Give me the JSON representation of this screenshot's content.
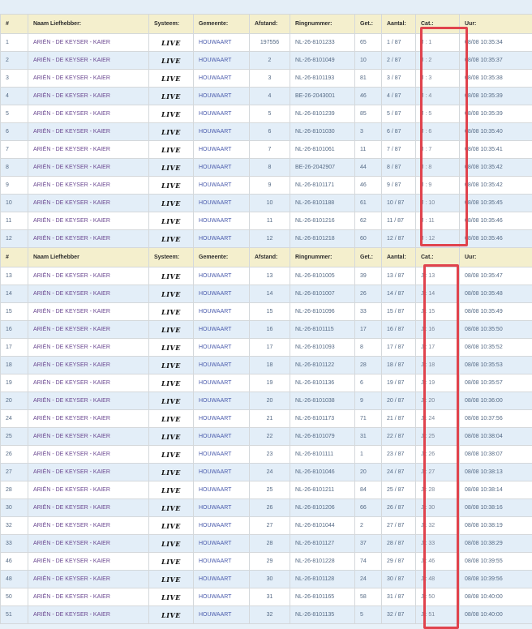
{
  "headers": {
    "nr": "#",
    "name": "Naam Liefhebber:",
    "system": "Systeem:",
    "gemeente": "Gemeente:",
    "afstand": "Afstand:",
    "ring": "Ringnummer:",
    "get": "Get.:",
    "aantal": "Aantal:",
    "cat": "Cat.:",
    "uur": "Uur:"
  },
  "headers2": {
    "nr": "#",
    "name": "Naam Liefhebber",
    "system": "Systeem:",
    "gemeente": "Gemeente:",
    "afstand": "Afstand:",
    "ring": "Ringnummer:",
    "get": "Get.:",
    "aantal": "Aantal:",
    "cat": "Cat.:",
    "uur": "Uur:"
  },
  "system_logo": "LIVE",
  "table1": [
    {
      "nr": "1",
      "name": "ARIËN - DE KEYSER - KAIER",
      "gem": "HOUWAART",
      "af": "197556",
      "ring": "NL-26-8101233",
      "get": "65",
      "aantal": "1 / 87",
      "cat": "J : 1",
      "uur": "08/08 10:35:34"
    },
    {
      "nr": "2",
      "name": "ARIËN - DE KEYSER - KAIER",
      "gem": "HOUWAART",
      "af": "2",
      "ring": "NL-26-8101049",
      "get": "10",
      "aantal": "2 / 87",
      "cat": "J : 2",
      "uur": "08/08 10:35:37"
    },
    {
      "nr": "3",
      "name": "ARIËN - DE KEYSER - KAIER",
      "gem": "HOUWAART",
      "af": "3",
      "ring": "NL-26-8101193",
      "get": "81",
      "aantal": "3 / 87",
      "cat": "J : 3",
      "uur": "08/08 10:35:38"
    },
    {
      "nr": "4",
      "name": "ARIËN - DE KEYSER - KAIER",
      "gem": "HOUWAART",
      "af": "4",
      "ring": "BE-26-2043001",
      "get": "46",
      "aantal": "4 / 87",
      "cat": "J : 4",
      "uur": "08/08 10:35:39"
    },
    {
      "nr": "5",
      "name": "ARIËN - DE KEYSER - KAIER",
      "gem": "HOUWAART",
      "af": "5",
      "ring": "NL-26-8101239",
      "get": "85",
      "aantal": "5 / 87",
      "cat": "J : 5",
      "uur": "08/08 10:35:39"
    },
    {
      "nr": "6",
      "name": "ARIËN - DE KEYSER - KAIER",
      "gem": "HOUWAART",
      "af": "6",
      "ring": "NL-26-8101030",
      "get": "3",
      "aantal": "6 / 87",
      "cat": "J : 6",
      "uur": "08/08 10:35:40"
    },
    {
      "nr": "7",
      "name": "ARIËN - DE KEYSER - KAIER",
      "gem": "HOUWAART",
      "af": "7",
      "ring": "NL-26-8101061",
      "get": "11",
      "aantal": "7 / 87",
      "cat": "J : 7",
      "uur": "08/08 10:35:41"
    },
    {
      "nr": "8",
      "name": "ARIËN - DE KEYSER - KAIER",
      "gem": "HOUWAART",
      "af": "8",
      "ring": "BE-26-2042907",
      "get": "44",
      "aantal": "8 / 87",
      "cat": "J : 8",
      "uur": "08/08 10:35:42"
    },
    {
      "nr": "9",
      "name": "ARIËN - DE KEYSER - KAIER",
      "gem": "HOUWAART",
      "af": "9",
      "ring": "NL-26-8101171",
      "get": "46",
      "aantal": "9 / 87",
      "cat": "J : 9",
      "uur": "08/08 10:35:42"
    },
    {
      "nr": "10",
      "name": "ARIËN - DE KEYSER - KAIER",
      "gem": "HOUWAART",
      "af": "10",
      "ring": "NL-26-8101188",
      "get": "61",
      "aantal": "10 / 87",
      "cat": "J : 10",
      "uur": "08/08 10:35:45"
    },
    {
      "nr": "11",
      "name": "ARIËN - DE KEYSER - KAIER",
      "gem": "HOUWAART",
      "af": "11",
      "ring": "NL-26-8101216",
      "get": "62",
      "aantal": "11 / 87",
      "cat": "J : 11",
      "uur": "08/08 10:35:46"
    },
    {
      "nr": "12",
      "name": "ARIËN - DE KEYSER - KAIER",
      "gem": "HOUWAART",
      "af": "12",
      "ring": "NL-26-8101218",
      "get": "60",
      "aantal": "12 / 87",
      "cat": "J : 12",
      "uur": "08/08 10:35:46"
    }
  ],
  "table2": [
    {
      "nr": "13",
      "name": "ARIËN - DE KEYSER - KAIER",
      "gem": "HOUWAART",
      "af": "13",
      "ring": "NL-26-8101005",
      "get": "39",
      "aantal": "13 / 87",
      "cat": "J : 13",
      "uur": "08/08 10:35:47"
    },
    {
      "nr": "14",
      "name": "ARIËN - DE KEYSER - KAIER",
      "gem": "HOUWAART",
      "af": "14",
      "ring": "NL-26-8101007",
      "get": "26",
      "aantal": "14 / 87",
      "cat": "J : 14",
      "uur": "08/08 10:35:48"
    },
    {
      "nr": "15",
      "name": "ARIËN - DE KEYSER - KAIER",
      "gem": "HOUWAART",
      "af": "15",
      "ring": "NL-26-8101096",
      "get": "33",
      "aantal": "15 / 87",
      "cat": "J : 15",
      "uur": "08/08 10:35:49"
    },
    {
      "nr": "16",
      "name": "ARIËN - DE KEYSER - KAIER",
      "gem": "HOUWAART",
      "af": "16",
      "ring": "NL-26-8101115",
      "get": "17",
      "aantal": "16 / 87",
      "cat": "J : 16",
      "uur": "08/08 10:35:50"
    },
    {
      "nr": "17",
      "name": "ARIËN - DE KEYSER - KAIER",
      "gem": "HOUWAART",
      "af": "17",
      "ring": "NL-26-8101093",
      "get": "8",
      "aantal": "17 / 87",
      "cat": "J : 17",
      "uur": "08/08 10:35:52"
    },
    {
      "nr": "18",
      "name": "ARIËN - DE KEYSER - KAIER",
      "gem": "HOUWAART",
      "af": "18",
      "ring": "NL-26-8101122",
      "get": "28",
      "aantal": "18 / 87",
      "cat": "J : 18",
      "uur": "08/08 10:35:53"
    },
    {
      "nr": "19",
      "name": "ARIËN - DE KEYSER - KAIER",
      "gem": "HOUWAART",
      "af": "19",
      "ring": "NL-26-8101136",
      "get": "6",
      "aantal": "19 / 87",
      "cat": "J : 19",
      "uur": "08/08 10:35:57"
    },
    {
      "nr": "20",
      "name": "ARIËN - DE KEYSER - KAIER",
      "gem": "HOUWAART",
      "af": "20",
      "ring": "NL-26-8101038",
      "get": "9",
      "aantal": "20 / 87",
      "cat": "J : 20",
      "uur": "08/08 10:36:00"
    },
    {
      "nr": "24",
      "name": "ARIËN - DE KEYSER - KAIER",
      "gem": "HOUWAART",
      "af": "21",
      "ring": "NL-26-8101173",
      "get": "71",
      "aantal": "21 / 87",
      "cat": "J : 24",
      "uur": "08/08 10:37:56"
    },
    {
      "nr": "25",
      "name": "ARIËN - DE KEYSER - KAIER",
      "gem": "HOUWAART",
      "af": "22",
      "ring": "NL-26-8101079",
      "get": "31",
      "aantal": "22 / 87",
      "cat": "J : 25",
      "uur": "08/08 10:38:04"
    },
    {
      "nr": "26",
      "name": "ARIËN - DE KEYSER - KAIER",
      "gem": "HOUWAART",
      "af": "23",
      "ring": "NL-26-8101111",
      "get": "1",
      "aantal": "23 / 87",
      "cat": "J : 26",
      "uur": "08/08 10:38:07"
    },
    {
      "nr": "27",
      "name": "ARIËN - DE KEYSER - KAIER",
      "gem": "HOUWAART",
      "af": "24",
      "ring": "NL-26-8101046",
      "get": "20",
      "aantal": "24 / 87",
      "cat": "J : 27",
      "uur": "08/08 10:38:13"
    },
    {
      "nr": "28",
      "name": "ARIËN - DE KEYSER - KAIER",
      "gem": "HOUWAART",
      "af": "25",
      "ring": "NL-26-8101211",
      "get": "84",
      "aantal": "25 / 87",
      "cat": "J : 28",
      "uur": "08/08 10:38:14"
    },
    {
      "nr": "30",
      "name": "ARIËN - DE KEYSER - KAIER",
      "gem": "HOUWAART",
      "af": "26",
      "ring": "NL-26-8101206",
      "get": "66",
      "aantal": "26 / 87",
      "cat": "J : 30",
      "uur": "08/08 10:38:16"
    },
    {
      "nr": "32",
      "name": "ARIËN - DE KEYSER - KAIER",
      "gem": "HOUWAART",
      "af": "27",
      "ring": "NL-26-8101044",
      "get": "2",
      "aantal": "27 / 87",
      "cat": "J : 32",
      "uur": "08/08 10:38:19"
    },
    {
      "nr": "33",
      "name": "ARIËN - DE KEYSER - KAIER",
      "gem": "HOUWAART",
      "af": "28",
      "ring": "NL-26-8101127",
      "get": "37",
      "aantal": "28 / 87",
      "cat": "J : 33",
      "uur": "08/08 10:38:29"
    },
    {
      "nr": "46",
      "name": "ARIËN - DE KEYSER - KAIER",
      "gem": "HOUWAART",
      "af": "29",
      "ring": "NL-26-8101228",
      "get": "74",
      "aantal": "29 / 87",
      "cat": "J : 46",
      "uur": "08/08 10:39:55"
    },
    {
      "nr": "48",
      "name": "ARIËN - DE KEYSER - KAIER",
      "gem": "HOUWAART",
      "af": "30",
      "ring": "NL-26-8101128",
      "get": "24",
      "aantal": "30 / 87",
      "cat": "J : 48",
      "uur": "08/08 10:39:56"
    },
    {
      "nr": "50",
      "name": "ARIËN - DE KEYSER - KAIER",
      "gem": "HOUWAART",
      "af": "31",
      "ring": "NL-26-8101165",
      "get": "58",
      "aantal": "31 / 87",
      "cat": "J : 50",
      "uur": "08/08 10:40:00"
    },
    {
      "nr": "51",
      "name": "ARIËN - DE KEYSER - KAIER",
      "gem": "HOUWAART",
      "af": "32",
      "ring": "NL-26-8101135",
      "get": "5",
      "aantal": "32 / 87",
      "cat": "J : 51",
      "uur": "08/08 10:40:00"
    }
  ],
  "highlight_color": "#e0434d"
}
